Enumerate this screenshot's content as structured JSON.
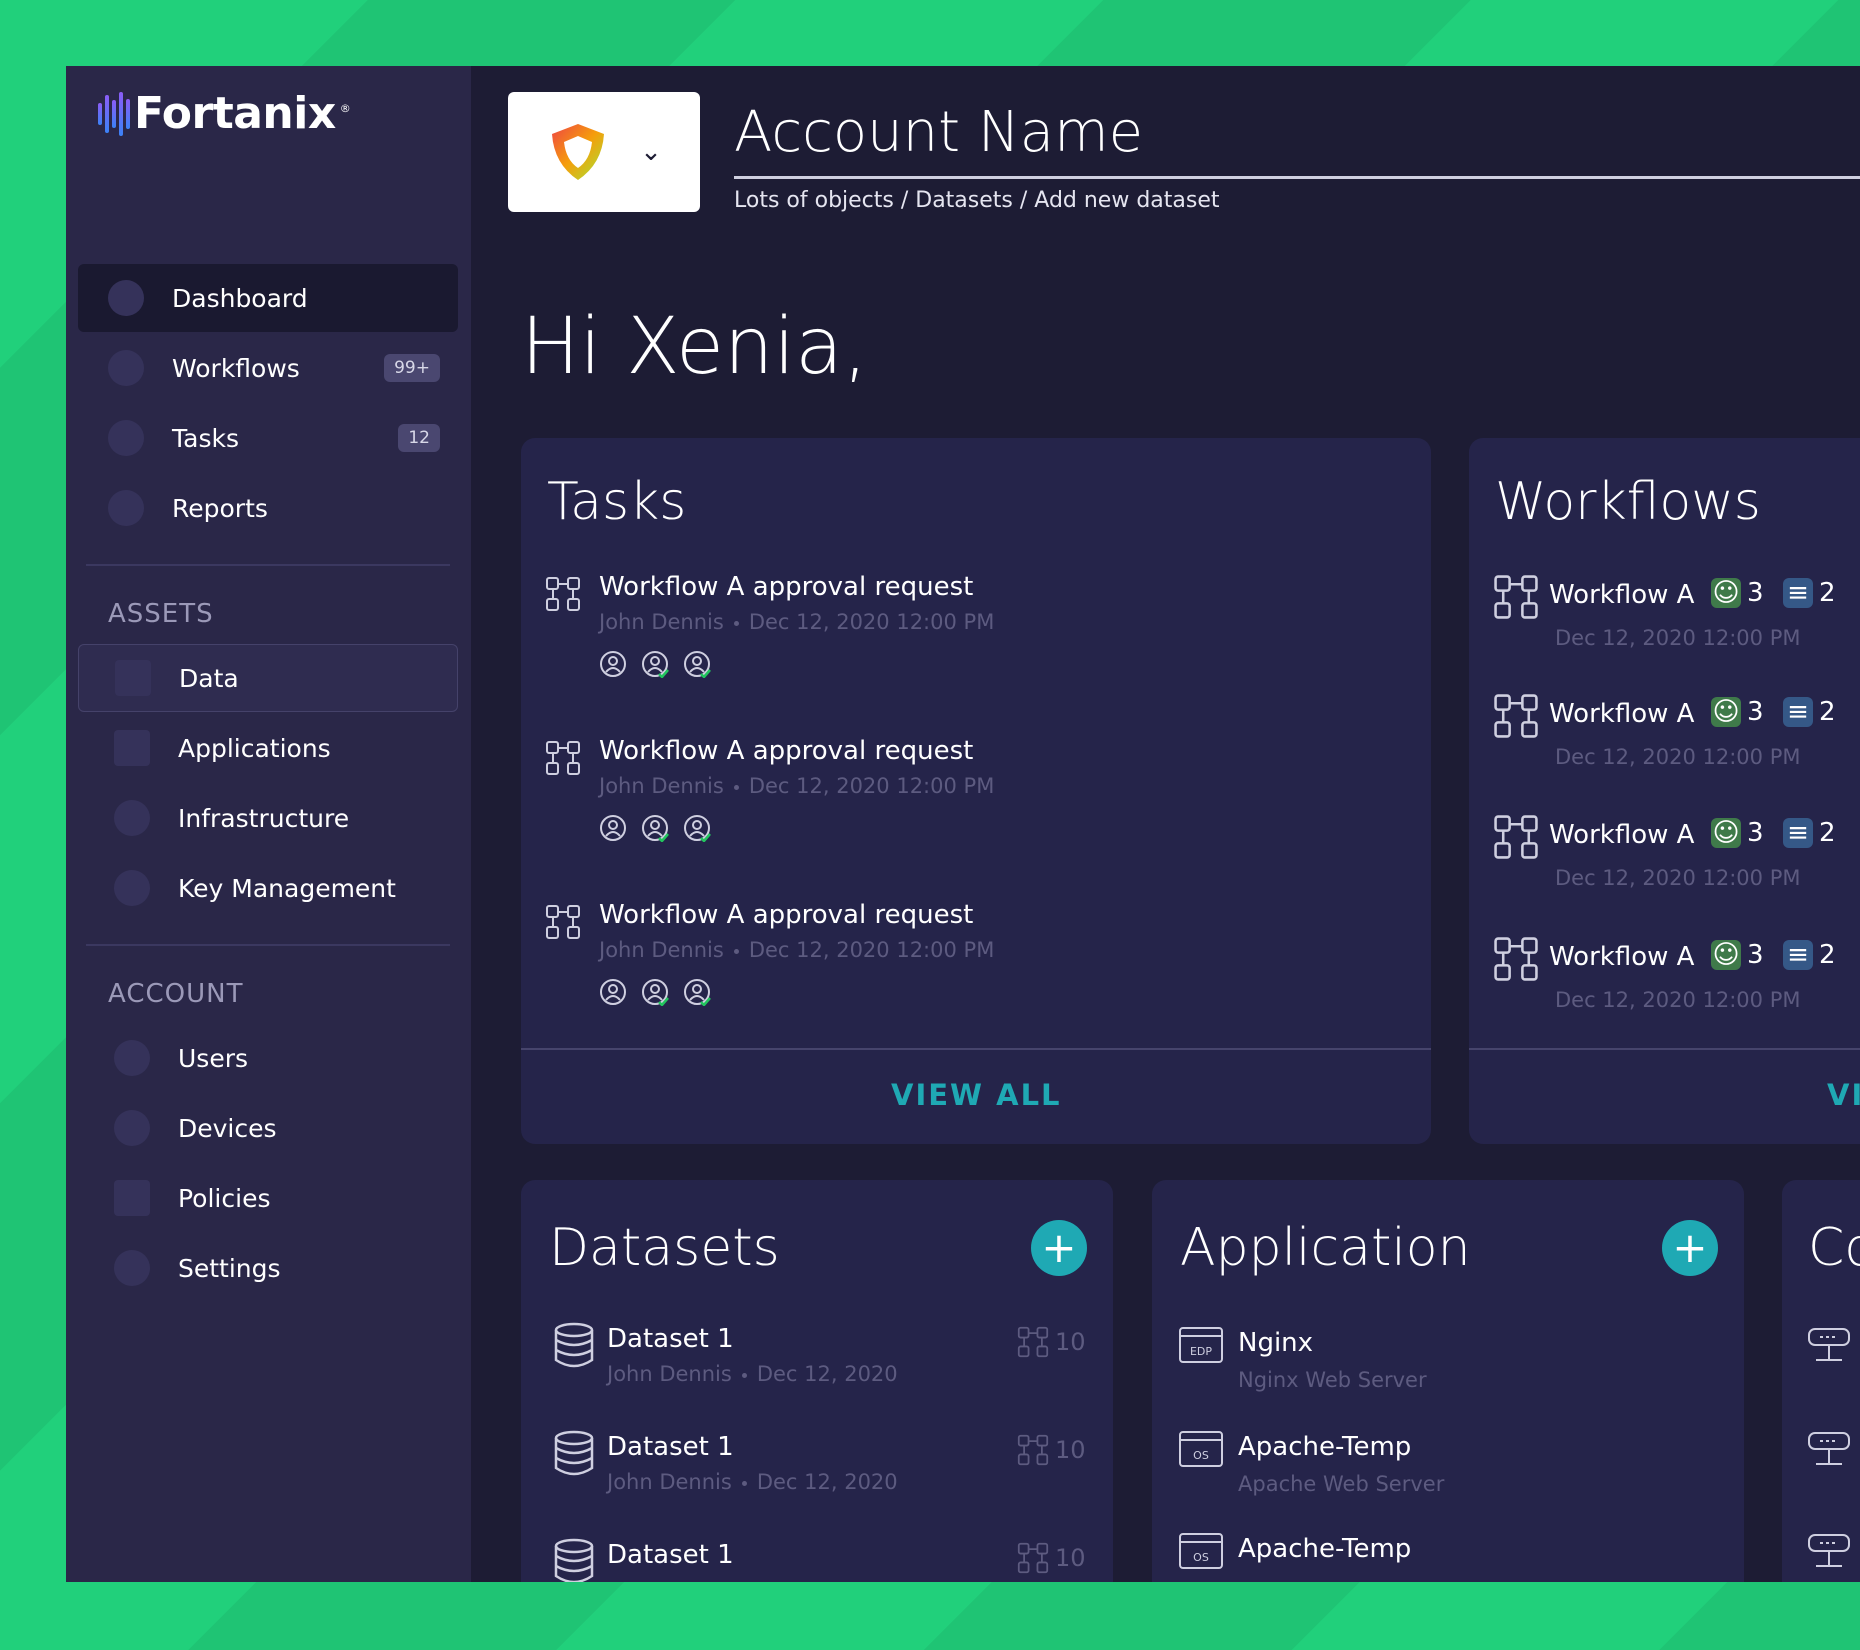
{
  "brand": {
    "name": "Fortanix",
    "reg": "®"
  },
  "sidebar": {
    "nav": [
      {
        "label": "Dashboard"
      },
      {
        "label": "Workflows",
        "badge": "99+"
      },
      {
        "label": "Tasks",
        "badge": "12"
      },
      {
        "label": "Reports"
      }
    ],
    "assets_label": "ASSETS",
    "assets": [
      {
        "label": "Data"
      },
      {
        "label": "Applications"
      },
      {
        "label": "Infrastructure"
      },
      {
        "label": "Key Management"
      }
    ],
    "account_label": "ACCOUNT",
    "account": [
      {
        "label": "Users"
      },
      {
        "label": "Devices"
      },
      {
        "label": "Policies"
      },
      {
        "label": "Settings"
      }
    ]
  },
  "header": {
    "account_name": "Account Name",
    "breadcrumb": "Lots of objects / Datasets / Add new dataset"
  },
  "greeting": "Hi Xenia,",
  "tasks_card": {
    "title": "Tasks",
    "items": [
      {
        "title": "Workflow A approval request",
        "user": "John Dennis",
        "date": "Dec 12, 2020 12:00 PM"
      },
      {
        "title": "Workflow A approval request",
        "user": "John Dennis",
        "date": "Dec 12, 2020 12:00 PM"
      },
      {
        "title": "Workflow A approval request",
        "user": "John Dennis",
        "date": "Dec 12, 2020 12:00 PM"
      }
    ],
    "view_all": "VIEW ALL"
  },
  "workflows_card": {
    "title": "Workflows",
    "items": [
      {
        "name": "Workflow A",
        "approvers": "3",
        "datasets": "2",
        "date": "Dec 12, 2020 12:00 PM"
      },
      {
        "name": "Workflow A",
        "approvers": "3",
        "datasets": "2",
        "date": "Dec 12, 2020 12:00 PM"
      },
      {
        "name": "Workflow A",
        "approvers": "3",
        "datasets": "2",
        "date": "Dec 12, 2020 12:00 PM"
      },
      {
        "name": "Workflow A",
        "approvers": "3",
        "datasets": "2",
        "date": "Dec 12, 2020 12:00 PM"
      }
    ],
    "view_all": "VI"
  },
  "datasets_card": {
    "title": "Datasets",
    "items": [
      {
        "name": "Dataset 1",
        "user": "John Dennis",
        "date": "Dec 12, 2020",
        "count": "10"
      },
      {
        "name": "Dataset 1",
        "user": "John Dennis",
        "date": "Dec 12, 2020",
        "count": "10"
      },
      {
        "name": "Dataset 1",
        "count": "10"
      }
    ]
  },
  "application_card": {
    "title": "Application",
    "items": [
      {
        "name": "Nginx",
        "desc": "Nginx Web Server",
        "tag": "EDP"
      },
      {
        "name": "Apache-Temp",
        "desc": "Apache Web Server",
        "tag": "OS"
      },
      {
        "name": "Apache-Temp",
        "tag": "OS"
      }
    ]
  },
  "third_card": {
    "title": "Co"
  },
  "colors": {
    "accent": "#1fa9b4",
    "background": "#1d1c34",
    "sidebar": "#2a2748",
    "card": "#25244a",
    "green_bg": "#22d07c"
  }
}
